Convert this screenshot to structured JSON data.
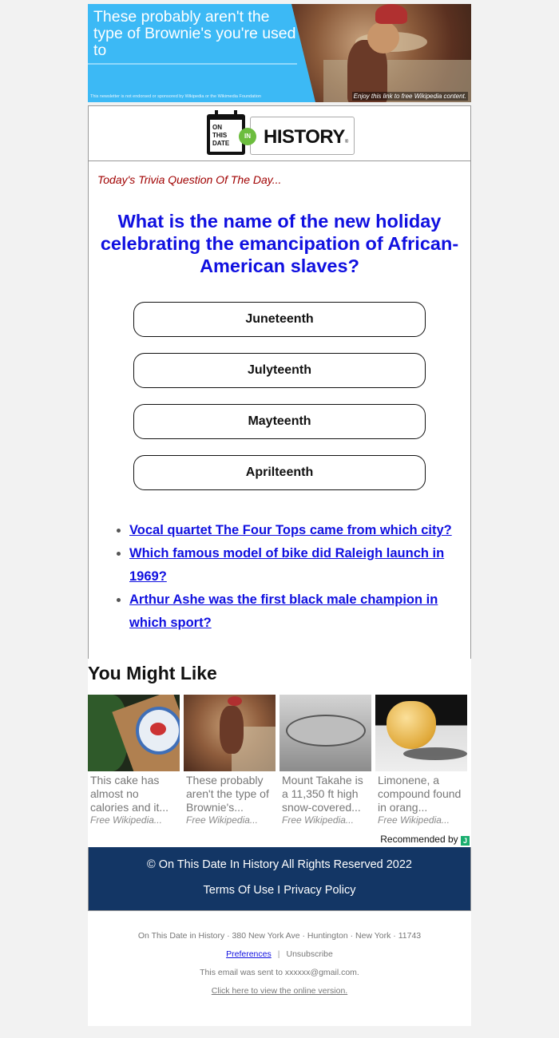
{
  "banner": {
    "title": "These probably aren't the type of Brownie's you're used to",
    "disclaimer": "This newsletter is not endorsed or sponsored by Wikipedia or the Wikimedia Foundation",
    "link_text": "Enjoy this link to free Wikipedia content."
  },
  "logo": {
    "calendar_text": "ON THIS DATE",
    "in_text": "IN",
    "history_text": "HISTORY",
    "trademark": "®"
  },
  "trivia": {
    "label": "Today's Trivia Question Of The Day...",
    "question": "What is the name of the new holiday celebrating the emancipation of African-American slaves?",
    "answers": [
      "Juneteenth",
      "Julyteenth",
      "Mayteenth",
      "Aprilteenth"
    ],
    "more_questions": [
      "Vocal quartet The Four Tops came from which city?",
      "Which famous model of bike did Raleigh launch in 1969?",
      "Arthur Ashe was the first black male champion in which sport?"
    ]
  },
  "recommendations": {
    "title": "You Might Like",
    "items": [
      {
        "caption": "This cake has almost no calories and it...",
        "source": "Free Wikipedia...",
        "image": "cake-plate"
      },
      {
        "caption": "These probably aren't the type of Brownie's...",
        "source": "Free Wikipedia...",
        "image": "brownie-painting"
      },
      {
        "caption": "Mount Takahe is a 11,350 ft high snow-covered...",
        "source": "Free Wikipedia...",
        "image": "mountain-aerial"
      },
      {
        "caption": "Limonene, a compound found in orang...",
        "source": "Free Wikipedia...",
        "image": "lemon"
      }
    ],
    "recommended_by": "Recommended by",
    "provider_logo_text": "J"
  },
  "footer": {
    "copyright": "© On This Date In History All Rights Reserved 2022",
    "terms": "Terms Of Use",
    "separator": "I",
    "privacy": "Privacy Policy",
    "address": "On This Date in History · 380 New York Ave · Huntington · New York · 11743",
    "preferences": "Preferences",
    "pipe": "|",
    "unsubscribe": "Unsubscribe",
    "sent_to": "This email was sent to xxxxxx@gmail.com.",
    "online_version": "Click here to view the online version."
  },
  "colors": {
    "banner_bg": "#3cb9f5",
    "question": "#1010e0",
    "trivia_label": "#a00000",
    "footer_bg": "#133665",
    "logo_green": "#6cbd3e"
  }
}
